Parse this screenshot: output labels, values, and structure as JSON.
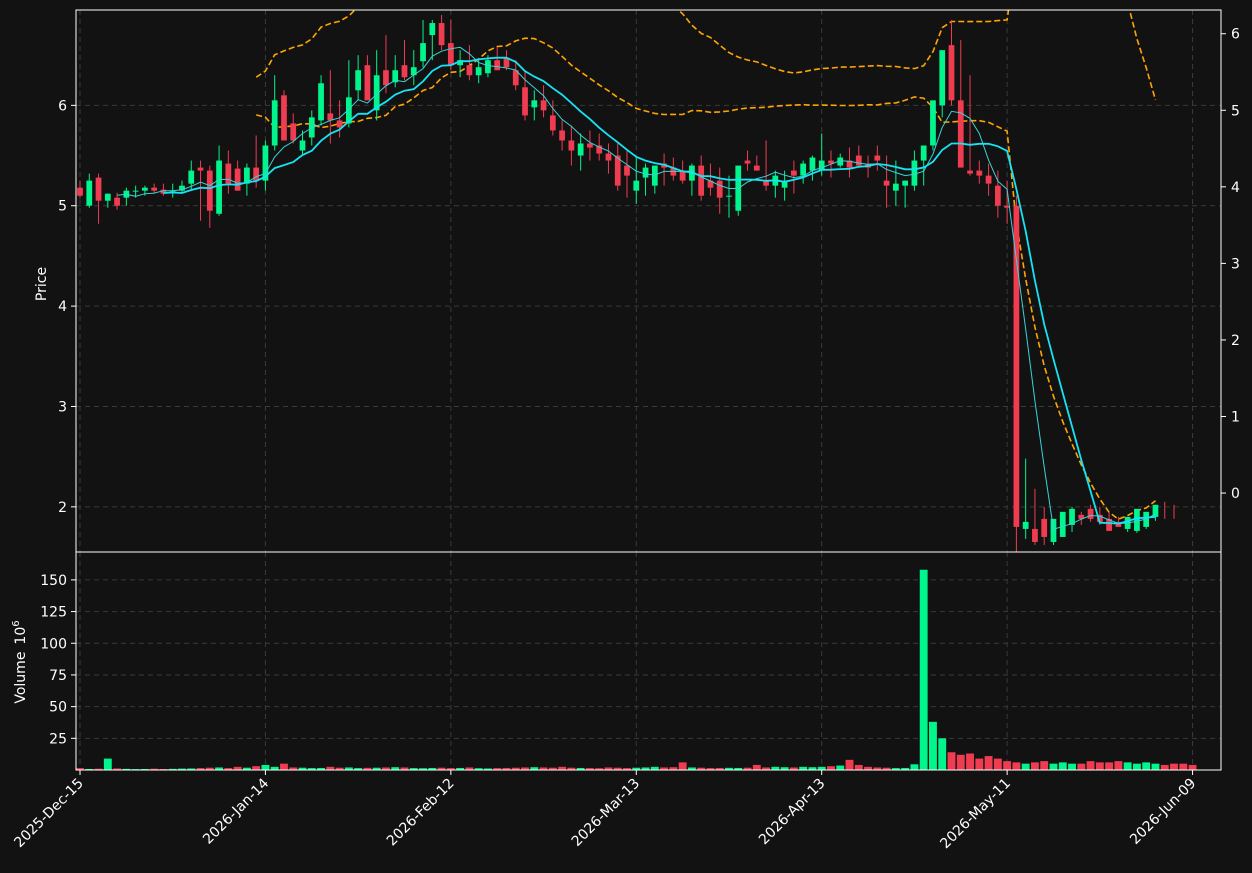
{
  "chart_data": {
    "type": "candlestick",
    "x": [
      "2025-12-15",
      "2025-12-16",
      "2025-12-17",
      "2025-12-18",
      "2025-12-19",
      "2025-12-22",
      "2025-12-23",
      "2025-12-24",
      "2025-12-26",
      "2025-12-29",
      "2025-12-30",
      "2025-12-31",
      "2026-01-02",
      "2026-01-05",
      "2026-01-06",
      "2026-01-07",
      "2026-01-08",
      "2026-01-09",
      "2026-01-12",
      "2026-01-13",
      "2026-01-14",
      "2026-01-15",
      "2026-01-16",
      "2026-01-20",
      "2026-01-21",
      "2026-01-22",
      "2026-01-23",
      "2026-01-26",
      "2026-01-27",
      "2026-01-28",
      "2026-01-29",
      "2026-01-30",
      "2026-02-02",
      "2026-02-03",
      "2026-02-04",
      "2026-02-05",
      "2026-02-06",
      "2026-02-09",
      "2026-02-10",
      "2026-02-11",
      "2026-02-12",
      "2026-02-13",
      "2026-02-17",
      "2026-02-18",
      "2026-02-19",
      "2026-02-20",
      "2026-02-23",
      "2026-02-24",
      "2026-02-25",
      "2026-02-26",
      "2026-02-27",
      "2026-03-02",
      "2026-03-03",
      "2026-03-04",
      "2026-03-05",
      "2026-03-06",
      "2026-03-09",
      "2026-03-10",
      "2026-03-11",
      "2026-03-12",
      "2026-03-13",
      "2026-03-16",
      "2026-03-17",
      "2026-03-18",
      "2026-03-19",
      "2026-03-20",
      "2026-03-23",
      "2026-03-24",
      "2026-03-25",
      "2026-03-26",
      "2026-03-27",
      "2026-03-30",
      "2026-03-31",
      "2026-04-01",
      "2026-04-02",
      "2026-04-06",
      "2026-04-07",
      "2026-04-08",
      "2026-04-09",
      "2026-04-10",
      "2026-04-13",
      "2026-04-14",
      "2026-04-15",
      "2026-04-16",
      "2026-04-17",
      "2026-04-20",
      "2026-04-21",
      "2026-04-22",
      "2026-04-23",
      "2026-04-24",
      "2026-04-27",
      "2026-04-28",
      "2026-04-29",
      "2026-04-30",
      "2026-05-01",
      "2026-05-04",
      "2026-05-05",
      "2026-05-06",
      "2026-05-07",
      "2026-05-08",
      "2026-05-11",
      "2026-05-12",
      "2026-05-13",
      "2026-05-14",
      "2026-05-15",
      "2026-05-18",
      "2026-05-19",
      "2026-05-20",
      "2026-05-21",
      "2026-05-22",
      "2026-05-26",
      "2026-05-27",
      "2026-05-28",
      "2026-05-29",
      "2026-06-01",
      "2026-06-02",
      "2026-06-03",
      "2026-06-04",
      "2026-06-05",
      "2026-06-08",
      "2026-06-09",
      "2026-06-10",
      "2026-06-11",
      "2026-06-12"
    ],
    "open": [
      5.18,
      5.0,
      5.28,
      5.05,
      5.08,
      5.08,
      5.14,
      5.15,
      5.18,
      5.16,
      5.15,
      5.15,
      5.22,
      5.38,
      5.35,
      4.92,
      5.42,
      5.37,
      5.22,
      5.38,
      5.25,
      5.6,
      6.1,
      5.82,
      5.55,
      5.68,
      5.85,
      5.92,
      5.85,
      5.82,
      6.15,
      6.4,
      5.95,
      6.35,
      6.23,
      6.4,
      6.3,
      6.44,
      6.7,
      6.82,
      6.62,
      6.4,
      6.4,
      6.3,
      6.32,
      6.45,
      6.47,
      6.35,
      6.18,
      5.98,
      6.05,
      5.9,
      5.75,
      5.65,
      5.5,
      5.62,
      5.6,
      5.52,
      5.5,
      5.4,
      5.15,
      5.28,
      5.2,
      5.42,
      5.38,
      5.35,
      5.25,
      5.4,
      5.25,
      5.25,
      5.1,
      4.95,
      5.45,
      5.4,
      5.25,
      5.2,
      5.18,
      5.35,
      5.3,
      5.35,
      5.35,
      5.45,
      5.4,
      5.45,
      5.5,
      5.42,
      5.5,
      5.25,
      5.15,
      5.2,
      5.2,
      5.45,
      5.6,
      6.0,
      6.6,
      6.05,
      5.35,
      5.35,
      5.3,
      5.2,
      5.0,
      5.0,
      1.78,
      1.78,
      1.88,
      1.65,
      1.7,
      1.82,
      1.92,
      1.98,
      1.92,
      1.88,
      1.85,
      1.78,
      1.76,
      1.8,
      1.9,
      1.98,
      1.95
    ],
    "high": [
      5.25,
      5.32,
      5.32,
      5.12,
      5.13,
      5.18,
      5.2,
      5.2,
      5.22,
      5.22,
      5.22,
      5.25,
      5.45,
      5.45,
      5.4,
      5.6,
      5.55,
      5.45,
      5.42,
      5.7,
      5.65,
      6.3,
      6.15,
      5.92,
      5.75,
      5.95,
      6.3,
      6.35,
      6.05,
      6.45,
      6.5,
      6.5,
      6.55,
      6.7,
      6.5,
      6.65,
      6.55,
      6.85,
      6.85,
      6.9,
      6.85,
      6.55,
      6.6,
      6.45,
      6.5,
      6.58,
      6.55,
      6.45,
      6.35,
      6.15,
      6.2,
      6.05,
      5.85,
      5.8,
      5.72,
      5.75,
      5.72,
      5.62,
      5.62,
      5.55,
      5.48,
      5.42,
      5.4,
      5.52,
      5.48,
      5.45,
      5.42,
      5.5,
      5.42,
      5.38,
      5.3,
      5.35,
      5.55,
      5.5,
      5.65,
      5.35,
      5.35,
      5.45,
      5.45,
      5.5,
      5.72,
      5.55,
      5.52,
      5.58,
      5.6,
      5.5,
      5.6,
      5.5,
      5.45,
      5.25,
      5.55,
      5.55,
      5.92,
      6.55,
      6.85,
      6.65,
      6.3,
      5.45,
      5.42,
      5.35,
      5.25,
      5.1,
      2.48,
      2.18,
      2.0,
      1.75,
      1.9,
      2.0,
      1.95,
      2.02,
      2.0,
      1.95,
      1.9,
      1.85,
      1.84,
      1.95,
      2.02,
      2.05,
      2.02
    ],
    "low": [
      5.08,
      4.98,
      4.82,
      4.98,
      4.96,
      5.0,
      5.08,
      5.1,
      5.12,
      5.1,
      5.08,
      5.12,
      5.15,
      4.85,
      4.78,
      4.9,
      5.12,
      5.15,
      5.1,
      5.18,
      5.15,
      5.55,
      5.8,
      5.62,
      5.5,
      5.6,
      5.8,
      5.62,
      5.68,
      5.78,
      6.05,
      6.12,
      5.85,
      6.12,
      6.18,
      6.25,
      6.2,
      6.38,
      6.45,
      6.55,
      6.35,
      6.28,
      6.25,
      6.22,
      6.28,
      6.35,
      6.35,
      6.15,
      5.85,
      5.85,
      5.88,
      5.7,
      5.55,
      5.4,
      5.35,
      5.45,
      5.45,
      5.32,
      5.15,
      5.08,
      5.02,
      5.1,
      5.12,
      5.2,
      5.25,
      5.22,
      5.1,
      5.05,
      5.1,
      4.92,
      4.88,
      4.9,
      5.35,
      5.35,
      5.15,
      5.08,
      5.05,
      5.12,
      5.22,
      5.25,
      5.3,
      5.28,
      5.38,
      5.28,
      5.38,
      5.28,
      5.35,
      4.98,
      5.0,
      4.98,
      5.15,
      5.2,
      5.55,
      5.88,
      6.0,
      5.9,
      5.3,
      5.22,
      5.1,
      4.88,
      4.82,
      1.55,
      1.68,
      1.62,
      1.62,
      1.62,
      1.7,
      1.75,
      1.82,
      1.85,
      1.82,
      1.78,
      1.8,
      1.75,
      1.74,
      1.78,
      1.86,
      1.88,
      1.88
    ],
    "close": [
      5.1,
      5.25,
      5.05,
      5.12,
      5.0,
      5.15,
      5.15,
      5.18,
      5.15,
      5.12,
      5.15,
      5.2,
      5.35,
      5.35,
      4.95,
      5.45,
      5.22,
      5.15,
      5.38,
      5.25,
      5.6,
      6.05,
      5.65,
      5.65,
      5.65,
      5.88,
      6.22,
      5.85,
      5.78,
      6.08,
      6.35,
      6.05,
      6.3,
      6.2,
      6.35,
      6.28,
      6.38,
      6.62,
      6.82,
      6.6,
      6.4,
      6.45,
      6.3,
      6.38,
      6.45,
      6.35,
      6.38,
      6.2,
      5.9,
      6.05,
      5.95,
      5.75,
      5.65,
      5.55,
      5.62,
      5.58,
      5.52,
      5.45,
      5.2,
      5.3,
      5.25,
      5.38,
      5.4,
      5.38,
      5.3,
      5.25,
      5.4,
      5.1,
      5.18,
      5.08,
      5.1,
      5.4,
      5.42,
      5.35,
      5.2,
      5.3,
      5.25,
      5.3,
      5.42,
      5.48,
      5.45,
      5.42,
      5.48,
      5.38,
      5.4,
      5.38,
      5.45,
      5.2,
      5.22,
      5.25,
      5.45,
      5.6,
      6.05,
      6.55,
      6.05,
      5.38,
      5.32,
      5.3,
      5.22,
      5.0,
      4.98,
      1.8,
      1.85,
      1.65,
      1.7,
      1.88,
      1.95,
      1.98,
      1.88,
      1.88,
      1.85,
      1.76,
      1.8,
      1.9,
      1.98,
      1.95,
      2.02
    ],
    "volume_unit": "10^6",
    "volume": [
      1.5,
      0.8,
      1.0,
      9.0,
      1.2,
      0.9,
      0.7,
      0.8,
      1.0,
      0.8,
      0.9,
      1.1,
      1.2,
      1.5,
      1.8,
      2.0,
      1.5,
      2.5,
      1.8,
      3.0,
      4.0,
      2.5,
      5.0,
      2.0,
      1.8,
      1.5,
      1.6,
      2.5,
      1.8,
      2.0,
      1.5,
      1.7,
      1.8,
      2.0,
      2.2,
      2.0,
      1.5,
      1.4,
      1.6,
      1.8,
      1.5,
      1.6,
      2.0,
      1.4,
      1.2,
      1.5,
      1.6,
      1.8,
      2.0,
      2.2,
      2.0,
      1.8,
      2.5,
      1.8,
      1.6,
      1.5,
      1.4,
      2.0,
      1.8,
      1.5,
      1.8,
      2.0,
      2.5,
      2.0,
      2.2,
      6.0,
      2.0,
      1.8,
      1.5,
      1.6,
      1.7,
      1.6,
      1.8,
      4.0,
      2.0,
      2.5,
      2.2,
      2.0,
      2.5,
      2.2,
      2.5,
      3.0,
      3.5,
      8.0,
      4.0,
      2.5,
      2.0,
      1.8,
      1.5,
      1.6,
      4.5,
      158,
      38,
      25,
      14,
      12,
      13,
      9,
      11,
      9,
      7,
      6,
      5,
      6,
      7,
      5,
      6,
      5,
      5,
      7,
      6,
      6,
      7,
      6,
      5,
      6,
      5,
      4,
      5,
      5,
      4
    ],
    "moving_averages": [
      5,
      10
    ],
    "bands_shown": true,
    "xticks": [
      "2025-Dec-15",
      "2026-Jan-14",
      "2026-Feb-12",
      "2026-Mar-13",
      "2026-Apr-13",
      "2026-May-11",
      "2026-Jun-09"
    ],
    "price_yticks": [
      2,
      3,
      4,
      5,
      6
    ],
    "secondary_yticks": [
      0,
      1,
      2,
      3,
      4,
      5,
      6
    ],
    "volume_yticks": [
      25,
      50,
      75,
      100,
      125,
      150
    ],
    "price_ylim": [
      1.55,
      6.95
    ],
    "secondary_ylim": [
      -0.77,
      6.31
    ],
    "volume_ylim": [
      0,
      172
    ],
    "ylabel": "Price",
    "volume_ylabel": "Volume",
    "volume_ylabel_exp": "10",
    "volume_ylabel_sup": "6",
    "colors": {
      "background": "#121212",
      "up": "#00f58c",
      "down": "#ef3c50",
      "ma_fast": "#3ad4d8",
      "ma_slow": "#16e4f4",
      "band": "#ffa500",
      "grid": "#3a3a3a",
      "frame": "#ffffff"
    },
    "grid": true
  }
}
